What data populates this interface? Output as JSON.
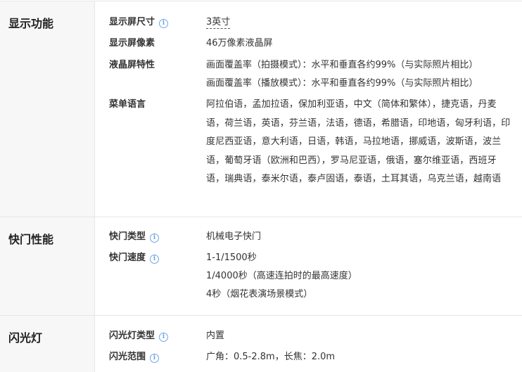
{
  "sections": [
    {
      "title": "显示功能",
      "rows": [
        {
          "label": "显示屏尺寸",
          "values": [
            "3英寸"
          ]
        },
        {
          "label": "显示屏像素",
          "values": [
            "46万像素液晶屏"
          ]
        },
        {
          "label": "液晶屏特性",
          "values": [
            "画面覆盖率（拍摄模式）：水平和垂直各约99%（与实际照片相比）",
            "画面覆盖率（播放模式）：水平和垂直各约99%（与实际照片相比）"
          ]
        },
        {
          "label": "菜单语言",
          "values": [
            "阿拉伯语，孟加拉语，保加利亚语，中文（简体和繁体），捷克语，丹麦语，荷兰语，英语，芬兰语，法语，德语，希腊语，印地语，匈牙利语，印度尼西亚语，意大利语，日语，韩语，马拉地语，挪威语，波斯语，波兰语，葡萄牙语（欧洲和巴西），罗马尼亚语，俄语，塞尔维亚语，西班牙语，瑞典语，泰米尔语，泰卢固语，泰语，土耳其语，乌克兰语，越南语"
          ]
        }
      ]
    },
    {
      "title": "快门性能",
      "rows": [
        {
          "label": "快门类型",
          "values": [
            "机械电子快门"
          ]
        },
        {
          "label": "快门速度",
          "values": [
            "1-1/1500秒",
            "1/4000秒（高速连拍时的最高速度）",
            "4秒（烟花表演场景模式）"
          ]
        }
      ]
    },
    {
      "title": "闪光灯",
      "rows": [
        {
          "label": "闪光灯类型",
          "values": [
            "内置"
          ]
        },
        {
          "label": "闪光范围",
          "values": [
            "广角：0.5-2.8m，长焦：2.0m"
          ]
        }
      ]
    }
  ],
  "icons": {
    "info": "info-circle-icon",
    "info_glyph": "i",
    "color": "#6ea6e6"
  }
}
